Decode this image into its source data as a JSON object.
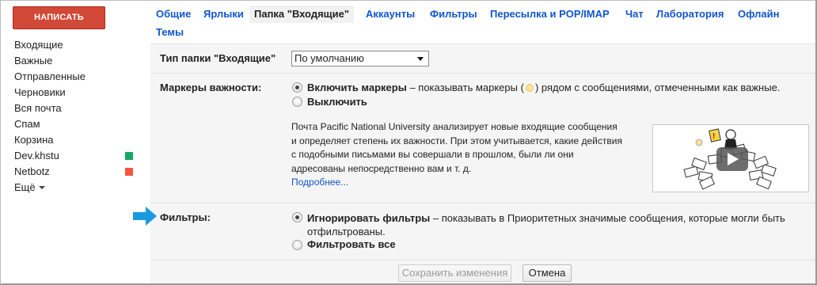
{
  "sidebar": {
    "compose_label": "НАПИСАТЬ",
    "items": [
      {
        "label": "Входящие"
      },
      {
        "label": "Важные"
      },
      {
        "label": "Отправленные"
      },
      {
        "label": "Черновики"
      },
      {
        "label": "Вся почта"
      },
      {
        "label": "Спам"
      },
      {
        "label": "Корзина"
      },
      {
        "label": "Dev.khstu",
        "color": "#16a765"
      },
      {
        "label": "Netbotz",
        "color": "#f4553e"
      }
    ],
    "more_label": "Ещё"
  },
  "tabs": [
    {
      "label": "Общие"
    },
    {
      "label": "Ярлыки"
    },
    {
      "label": "Папка \"Входящие\"",
      "active": true
    },
    {
      "label": "Аккаунты"
    },
    {
      "label": "Фильтры"
    },
    {
      "label": "Пересылка и POP/IMAP"
    },
    {
      "label": "Чат"
    },
    {
      "label": "Лаборатория"
    },
    {
      "label": "Офлайн"
    },
    {
      "label": "Темы"
    }
  ],
  "inbox_type": {
    "label": "Тип папки \"Входящие\"",
    "selected": "По умолчанию"
  },
  "importance_markers": {
    "label": "Маркеры важности:",
    "enable_bold": "Включить маркеры",
    "enable_rest_before": " – показывать маркеры (",
    "enable_rest_after": ") рядом с сообщениями, отмеченными как важные.",
    "disable": "Выключить",
    "description": "Почта Pacific National University анализирует новые входящие сообщения и определяет степень их важности. При этом учитывается, какие действия с подобными письмами вы совершали в прошлом, были ли они адресованы непосредственно вам и т. д.",
    "more_link": "Подробнее..."
  },
  "filters": {
    "label": "Фильтры:",
    "ignore_bold": "Игнорировать фильтры",
    "ignore_rest": " – показывать в Приоритетных значимые сообщения, которые могли быть",
    "ignore_rest_line2": "отфильтрованы.",
    "filter_all": "Фильтровать все"
  },
  "actions": {
    "save": "Сохранить изменения",
    "cancel": "Отмена"
  },
  "colors": {
    "compose": "#d14836",
    "link": "#1155cc",
    "pointer_arrow": "#1a9be0"
  }
}
